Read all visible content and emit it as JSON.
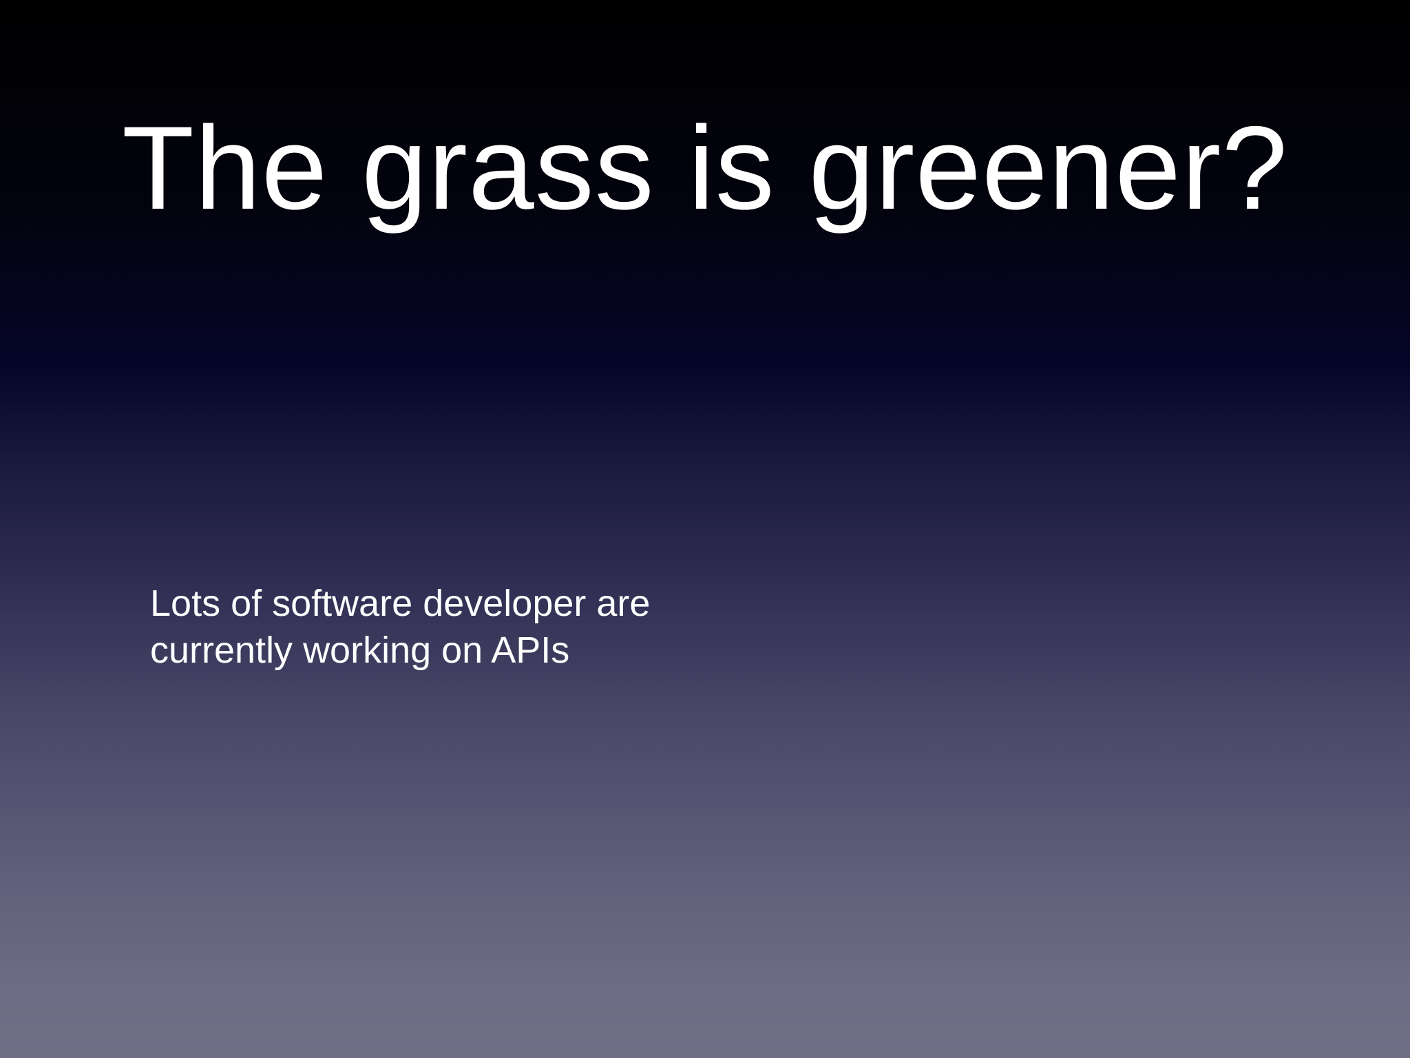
{
  "slide": {
    "title": "The grass is greener?",
    "body_lines": [
      "Lots of software developer are",
      "currently working on APIs"
    ]
  },
  "colors": {
    "background_top": "#000000",
    "background_bottom": "#716f86",
    "text": "#ffffff"
  }
}
